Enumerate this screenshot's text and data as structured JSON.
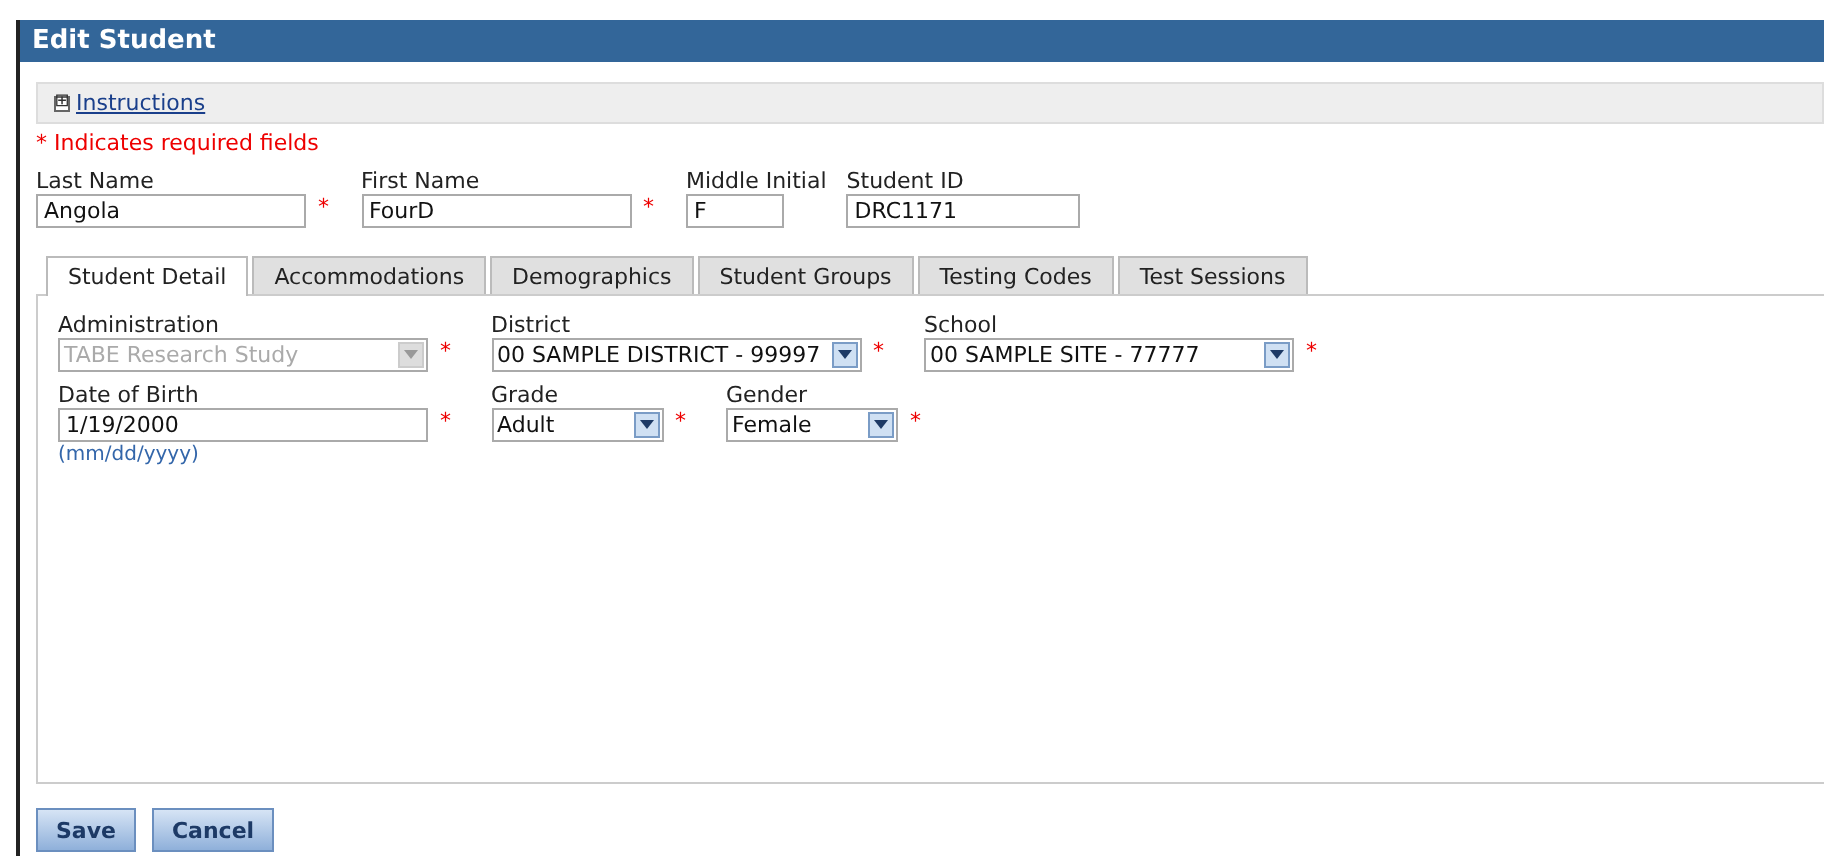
{
  "window": {
    "title": "Edit Student"
  },
  "instructions": {
    "label": "Instructions",
    "icon": "⊞",
    "expanded": false
  },
  "required_note": "* Indicates required fields",
  "name_fields": [
    {
      "label": "Last Name",
      "value": "Angola",
      "required_mark": "*"
    },
    {
      "label": "First Name",
      "value": "FourD",
      "required_mark": "*"
    },
    {
      "label": "Middle Initial",
      "value": "F"
    },
    {
      "label": "Student ID",
      "value": "DRC1171"
    }
  ],
  "tabs": [
    {
      "label": "Student Detail",
      "selected": true
    },
    {
      "label": "Accommodations",
      "selected": false
    },
    {
      "label": "Demographics",
      "selected": false
    },
    {
      "label": "Student Groups",
      "selected": false
    },
    {
      "label": "Testing Codes",
      "selected": false
    },
    {
      "label": "Test Sessions",
      "selected": false
    }
  ],
  "detail_rows": [
    [
      {
        "kind": "select",
        "label": "Administration",
        "value": "TABE Research Study",
        "required_mark": "*",
        "disabled": true
      },
      {
        "kind": "select",
        "label": "District",
        "value": "00 SAMPLE DISTRICT - 99997",
        "required_mark": "*",
        "disabled": false
      },
      {
        "kind": "select",
        "label": "School",
        "value": "00 SAMPLE SITE - 77777",
        "required_mark": "*",
        "disabled": false
      }
    ],
    [
      {
        "kind": "text",
        "label": "Date of Birth",
        "value": "1/19/2000",
        "hint": "(mm/dd/yyyy)",
        "required_mark": "*"
      },
      {
        "kind": "select",
        "label": "Grade",
        "value": "Adult",
        "required_mark": "*",
        "disabled": false
      },
      {
        "kind": "select",
        "label": "Gender",
        "value": "Female",
        "required_mark": "*",
        "disabled": false
      }
    ]
  ],
  "buttons": [
    "Save",
    "Cancel"
  ]
}
